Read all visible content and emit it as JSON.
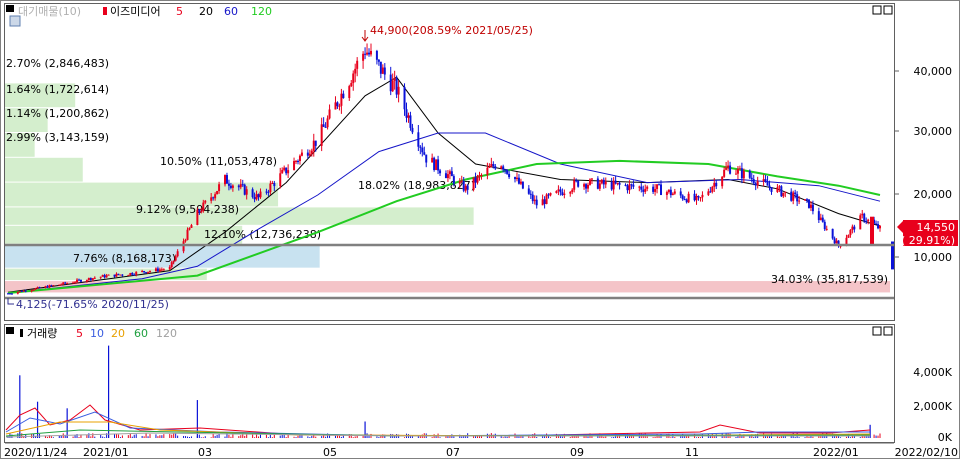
{
  "header": {
    "legend_prefix": "대기매물(10)",
    "stock_name": "이즈미디어",
    "ma": [
      "5",
      "20",
      "60",
      "120"
    ]
  },
  "volume_header": {
    "title": "거래량",
    "ma": [
      "5",
      "10",
      "20",
      "60",
      "120"
    ]
  },
  "colors": {
    "up": "#e8001c",
    "down": "#0a12d8",
    "ma5": "#e8001c",
    "ma20": "#000000",
    "ma60": "#1515c8",
    "ma120": "#22cc22",
    "ma5_vol": "#e8001c",
    "ma10_vol": "#3a5de0",
    "ma20_vol": "#e8a000",
    "ma60_vol": "#20a040",
    "ma120_vol": "#a0a0a0",
    "current_price_box": "#e8001c"
  },
  "icons": [
    "chart-settings-icon",
    "maximize-icon",
    "close-icon"
  ],
  "chart_data": [
    {
      "type": "candlestick",
      "title": "이즈미디어",
      "x": [
        "2020/11/24",
        "2021/01",
        "03",
        "05",
        "07",
        "09",
        "11",
        "2022/01",
        "2022/02/10"
      ],
      "ylim": [
        3000,
        46000
      ],
      "y_ticks": [
        "10,000",
        "20,000",
        "30,000",
        "40,000"
      ],
      "grid": false,
      "legend": "top-left",
      "annotations": [
        {
          "label": "44,900(208.59% 2021/05/25)",
          "kind": "high"
        },
        {
          "label": "4,125(-71.65% 2020/11/25)",
          "kind": "low"
        }
      ],
      "current_price": {
        "value": "14,550",
        "change": "( 29.91%)"
      },
      "close_series": [
        {
          "date": "2020/11/25",
          "close": 4125
        },
        {
          "date": "2020/12/20",
          "close": 5500
        },
        {
          "date": "2021/01/10",
          "close": 6800
        },
        {
          "date": "2021/01/25",
          "close": 7300
        },
        {
          "date": "2021/02/15",
          "close": 8200
        },
        {
          "date": "2021/03/01",
          "close": 17000
        },
        {
          "date": "2021/03/15",
          "close": 22500
        },
        {
          "date": "2021/04/01",
          "close": 19500
        },
        {
          "date": "2021/04/15",
          "close": 24000
        },
        {
          "date": "2021/05/01",
          "close": 29000
        },
        {
          "date": "2021/05/25",
          "close": 43500
        },
        {
          "date": "2021/06/10",
          "close": 37000
        },
        {
          "date": "2021/06/25",
          "close": 26000
        },
        {
          "date": "2021/07/15",
          "close": 21000
        },
        {
          "date": "2021/08/01",
          "close": 25500
        },
        {
          "date": "2021/08/20",
          "close": 18500
        },
        {
          "date": "2021/09/10",
          "close": 22000
        },
        {
          "date": "2021/10/01",
          "close": 21500
        },
        {
          "date": "2021/10/20",
          "close": 21000
        },
        {
          "date": "2021/11/10",
          "close": 19000
        },
        {
          "date": "2021/11/25",
          "close": 24500
        },
        {
          "date": "2021/12/15",
          "close": 21500
        },
        {
          "date": "2022/01/05",
          "close": 18500
        },
        {
          "date": "2022/01/20",
          "close": 11800
        },
        {
          "date": "2022/02/01",
          "close": 16500
        },
        {
          "date": "2022/02/10",
          "close": 14550
        }
      ],
      "moving_averages": [
        {
          "name": "20",
          "points": [
            [
              "2020/11/25",
              4300
            ],
            [
              "2021/02/15",
              7800
            ],
            [
              "2021/03/15",
              14000
            ],
            [
              "2021/04/15",
              22000
            ],
            [
              "2021/05/25",
              36000
            ],
            [
              "2021/06/10",
              39000
            ],
            [
              "2021/07/01",
              30000
            ],
            [
              "2021/07/20",
              25000
            ],
            [
              "2021/09/01",
              22500
            ],
            [
              "2021/10/15",
              22000
            ],
            [
              "2021/11/25",
              22500
            ],
            [
              "2021/12/20",
              21000
            ],
            [
              "2022/01/20",
              17000
            ],
            [
              "2022/02/10",
              15000
            ]
          ]
        },
        {
          "name": "60",
          "points": [
            [
              "2020/11/25",
              4200
            ],
            [
              "2021/02/01",
              6500
            ],
            [
              "2021/03/01",
              8500
            ],
            [
              "2021/04/01",
              14500
            ],
            [
              "2021/05/01",
              20000
            ],
            [
              "2021/06/01",
              27000
            ],
            [
              "2021/07/01",
              30000
            ],
            [
              "2021/07/25",
              30000
            ],
            [
              "2021/09/01",
              25000
            ],
            [
              "2021/10/15",
              22000
            ],
            [
              "2021/12/01",
              22500
            ],
            [
              "2022/01/10",
              21500
            ],
            [
              "2022/02/10",
              19000
            ]
          ]
        },
        {
          "name": "120",
          "points": [
            [
              "2020/11/25",
              4200
            ],
            [
              "2021/03/01",
              7000
            ],
            [
              "2021/05/01",
              14000
            ],
            [
              "2021/06/10",
              19000
            ],
            [
              "2021/07/15",
              22500
            ],
            [
              "2021/08/20",
              25000
            ],
            [
              "2021/10/01",
              25500
            ],
            [
              "2021/11/15",
              25000
            ],
            [
              "2021/12/20",
              23000
            ],
            [
              "2022/01/20",
              21500
            ],
            [
              "2022/02/10",
              20000
            ]
          ]
        }
      ],
      "volume_profile": [
        {
          "label": "2.70% (2,846,483)",
          "pct": 2.7
        },
        {
          "label": "1.64% (1,722,614)",
          "pct": 1.64
        },
        {
          "label": "1.14% (1,200,862)",
          "pct": 1.14
        },
        {
          "label": "2.99% (3,143,159)",
          "pct": 2.99
        },
        {
          "label": "10.50% (11,053,478)",
          "pct": 10.5
        },
        {
          "label": "18.02% (18,983,827)",
          "pct": 18.02
        },
        {
          "label": "9.12% (9,594,238)",
          "pct": 9.12
        },
        {
          "label": "12.10% (12,736,238)",
          "pct": 12.1
        },
        {
          "label": "7.76% (8,168,173)",
          "pct": 7.76
        },
        {
          "label": "34.03% (35,817,539)",
          "pct": 34.03
        }
      ]
    },
    {
      "type": "bar",
      "title": "거래량",
      "ylim": [
        0,
        6000
      ],
      "y_ticks": [
        "0K",
        "2,000K",
        "4,000K"
      ],
      "values_k": [
        {
          "date": "2020/12/01",
          "volume": 3800
        },
        {
          "date": "2020/12/10",
          "volume": 2200
        },
        {
          "date": "2020/12/25",
          "volume": 1800
        },
        {
          "date": "2021/01/15",
          "volume": 5600
        },
        {
          "date": "2021/03/01",
          "volume": 2300
        },
        {
          "date": "2021/05/25",
          "volume": 1000
        },
        {
          "date": "2022/02/05",
          "volume": 800
        }
      ]
    }
  ]
}
